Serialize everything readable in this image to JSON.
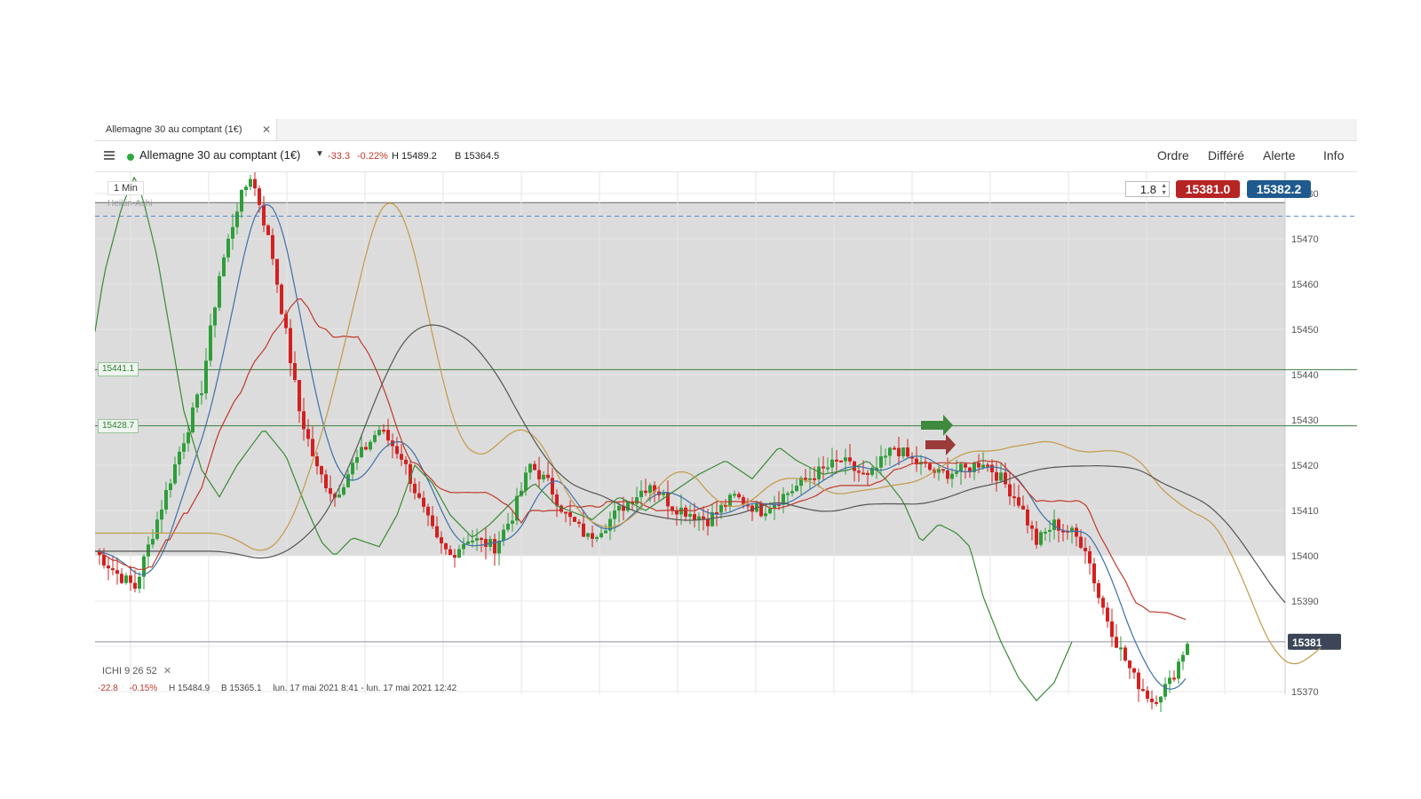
{
  "tab": {
    "label": "Allemagne 30 au comptant (1€)",
    "close": "✕"
  },
  "header": {
    "instrument": "Allemagne 30 au comptant (1€)",
    "change": "-33.3",
    "change_pct": "-0.22%",
    "high": "H 15489.2",
    "low": "B 15364.5",
    "menu": [
      "Ordre",
      "Différé",
      "Alerte",
      "Info"
    ]
  },
  "chart_controls": {
    "timeframe": "1 Min",
    "chart_type": "Heikin-Ashi",
    "quantity": "1.8",
    "sell_price": "15381.0",
    "buy_price": "15382.2"
  },
  "levels": [
    "15441.1",
    "15428.7"
  ],
  "indicator": {
    "name": "ICHI",
    "params": [
      "9",
      "26",
      "52"
    ],
    "close": "✕"
  },
  "stats": {
    "change": "-22.8",
    "change_pct": "-0.15%",
    "high": "H 15484.9",
    "low": "B 15365.1",
    "range": "lun. 17 mai 2021 8:41 - lun. 17 mai 2021 12:42"
  },
  "colors": {
    "up": "#2e9e3a",
    "down": "#d32020",
    "kijun": "#c0392b",
    "tenkan": "#3e6fa8",
    "chikou": "#3a8a35",
    "span_a": "#c29a4a",
    "span_b": "#555555"
  },
  "chart_data": {
    "type": "candlestick",
    "y_axis_ticks": [
      "15480",
      "15470",
      "15460",
      "15450",
      "15440",
      "15430",
      "15420",
      "15410",
      "15400",
      "15390",
      "15380",
      "15370"
    ],
    "current_price": "15381",
    "ylim": [
      15368,
      15484
    ]
  }
}
